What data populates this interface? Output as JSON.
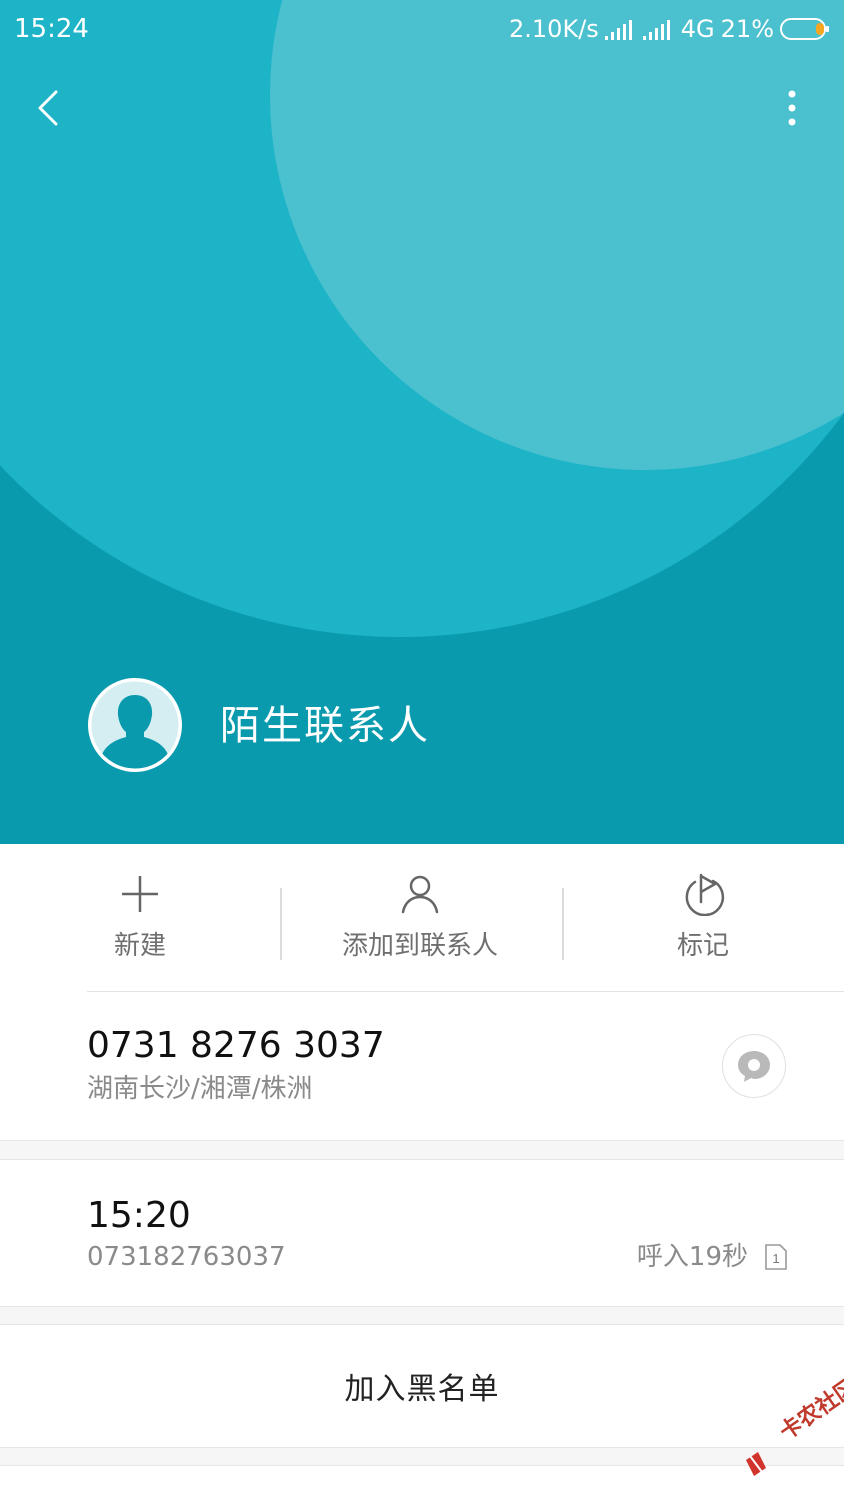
{
  "status_bar": {
    "time": "15:24",
    "network_speed": "2.10K/s",
    "network_type": "4G",
    "battery_percent": "21%",
    "battery_level": 0.21
  },
  "header": {
    "back_icon": "chevron-left-icon",
    "more_icon": "more-vertical-icon",
    "contact_name": "陌生联系人",
    "colors": {
      "background": "#0a9aae",
      "circle_large": "#1db4c8",
      "circle_light": "#4bc0cf"
    }
  },
  "actions": [
    {
      "label": "新建",
      "icon": "plus-icon"
    },
    {
      "label": "添加到联系人",
      "icon": "person-icon"
    },
    {
      "label": "标记",
      "icon": "flag-icon"
    }
  ],
  "number": {
    "phone": "0731 8276 3037",
    "location": "湖南长沙/湘潭/株洲",
    "message_icon": "message-bubble-icon"
  },
  "call_log": {
    "time": "15:20",
    "number": "073182763037",
    "detail": "呼入19秒",
    "sim_label": "1"
  },
  "blacklist": {
    "label": "加入黑名单"
  },
  "watermark": {
    "text": "卡农社区"
  }
}
